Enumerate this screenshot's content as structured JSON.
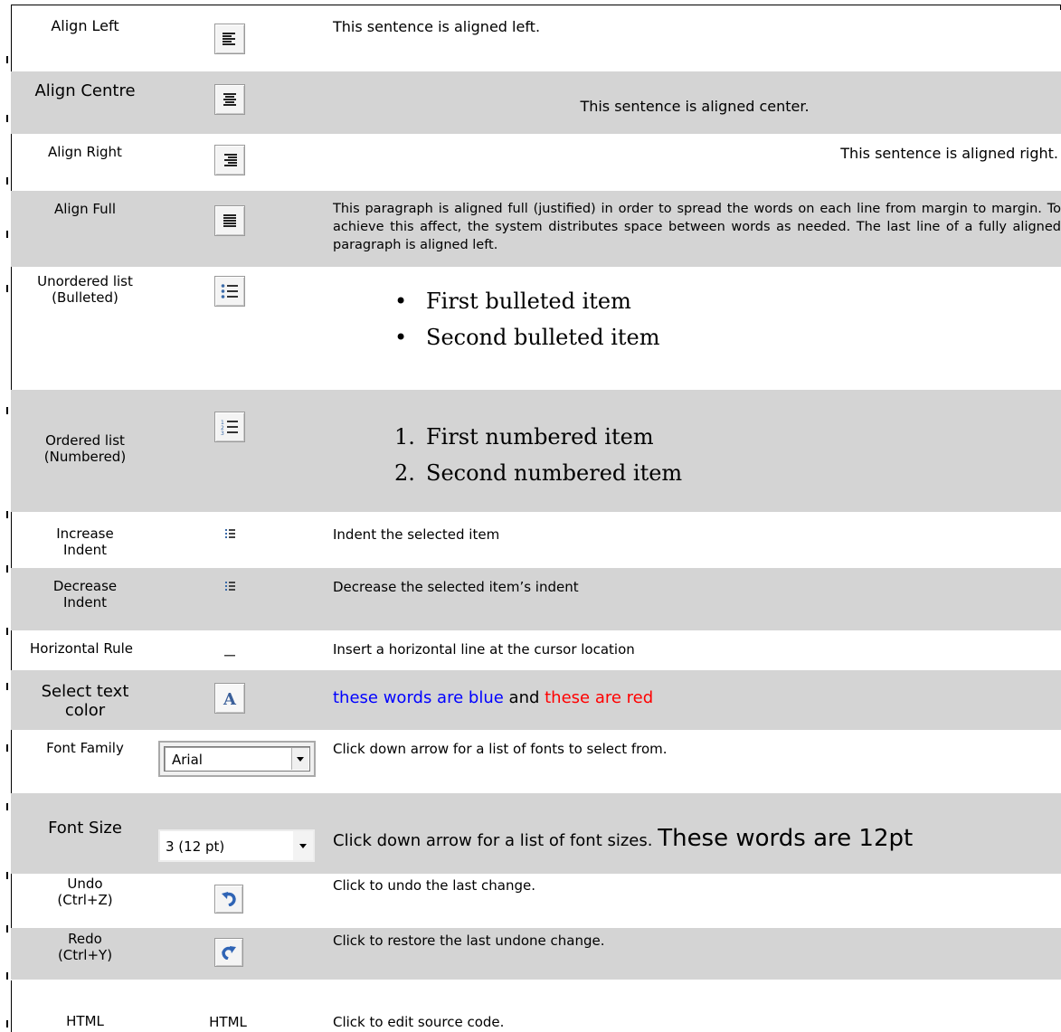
{
  "rows": [
    {
      "label": "Align Left",
      "description": "This sentence is aligned left.",
      "icon": "align-left-icon"
    },
    {
      "label": "Align Centre",
      "description": "This sentence is aligned center.",
      "icon": "align-center-icon"
    },
    {
      "label": "Align Right",
      "description": "This sentence is aligned right.",
      "icon": "align-right-icon"
    },
    {
      "label": "Align Full",
      "description": "This paragraph is aligned full (justified) in order to spread the words on each line from margin to margin. To achieve this affect, the system distributes space between words as needed. The last line of a fully aligned paragraph is aligned left.",
      "icon": "align-justify-icon"
    },
    {
      "label_line1": "Unordered list",
      "label_line2": "(Bulleted)",
      "items": [
        "First bulleted item",
        "Second bulleted item"
      ],
      "icon": "bulleted-list-icon"
    },
    {
      "label_line1": "Ordered list",
      "label_line2": "(Numbered)",
      "items": [
        "First numbered item",
        "Second numbered item"
      ],
      "numbers": [
        "1.",
        "2."
      ],
      "icon": "numbered-list-icon"
    },
    {
      "label_line1": "Increase",
      "label_line2": "Indent",
      "description": "Indent the selected item",
      "icon": "increase-indent-icon"
    },
    {
      "label_line1": "Decrease",
      "label_line2": "Indent",
      "description": "Decrease the selected item’s indent",
      "icon": "decrease-indent-icon"
    },
    {
      "label": "Horizontal Rule",
      "description": "Insert a horizontal line at the cursor location",
      "icon": "horizontal-rule-icon"
    },
    {
      "label_line1": "Select text",
      "label_line2": "color",
      "blue_text": "these words are blue",
      "and_text": " and ",
      "red_text": "these are red",
      "icon": "text-color-icon",
      "blue_color": "#0000ff",
      "red_color": "#ff0000"
    },
    {
      "label": "Font Family",
      "description": "Click down arrow for a list of fonts to select from.",
      "select_value": "Arial"
    },
    {
      "label": "Font Size",
      "description": "Click down arrow for a list of font sizes. ",
      "big_text": "These words are 12pt",
      "select_value": "3 (12 pt)"
    },
    {
      "label_line1": "Undo",
      "label_line2": "(Ctrl+Z)",
      "description": "Click to undo the last change.",
      "icon": "undo-icon"
    },
    {
      "label_line1": "Redo",
      "label_line2": "(Ctrl+Y)",
      "description": "Click to restore the last undone change.",
      "icon": "redo-icon"
    },
    {
      "label": "HTML",
      "button_text": "HTML",
      "description": "Click to edit source code."
    }
  ],
  "colors": {
    "row_shade": "#d4d4d4",
    "icon_blue": "#3a6aa8"
  }
}
